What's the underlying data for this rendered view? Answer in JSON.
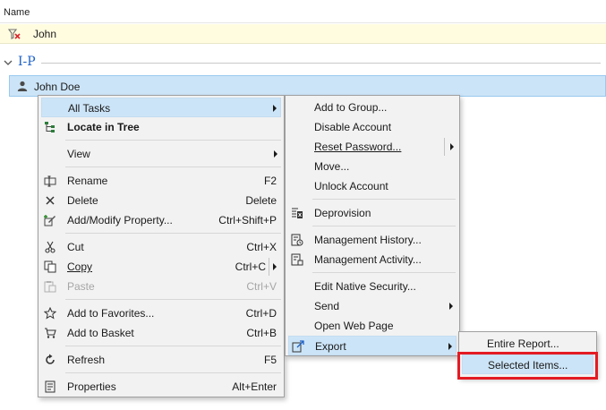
{
  "header": {
    "column_name": "Name"
  },
  "filter": {
    "value": "John"
  },
  "group": {
    "title": "I-P"
  },
  "selected_row": {
    "name": "John Doe"
  },
  "context_menu": {
    "all_tasks": "All Tasks",
    "locate_in_tree": "Locate in Tree",
    "view": "View",
    "rename": {
      "label": "Rename",
      "shortcut": "F2"
    },
    "delete": {
      "label": "Delete",
      "shortcut": "Delete"
    },
    "add_modify_property": {
      "label": "Add/Modify Property...",
      "shortcut": "Ctrl+Shift+P"
    },
    "cut": {
      "label": "Cut",
      "shortcut": "Ctrl+X"
    },
    "copy": {
      "label": "Copy",
      "shortcut": "Ctrl+C"
    },
    "paste": {
      "label": "Paste",
      "shortcut": "Ctrl+V"
    },
    "add_to_favorites": {
      "label": "Add to Favorites...",
      "shortcut": "Ctrl+D"
    },
    "add_to_basket": {
      "label": "Add to Basket",
      "shortcut": "Ctrl+B"
    },
    "refresh": {
      "label": "Refresh",
      "shortcut": "F5"
    },
    "properties": {
      "label": "Properties",
      "shortcut": "Alt+Enter"
    }
  },
  "all_tasks_menu": {
    "add_to_group": "Add to Group...",
    "disable_account": "Disable Account",
    "reset_password": "Reset Password...",
    "move": "Move...",
    "unlock_account": "Unlock Account",
    "deprovision": "Deprovision",
    "management_history": "Management History...",
    "management_activity": "Management Activity...",
    "edit_native_security": "Edit Native Security...",
    "send": "Send",
    "open_web_page": "Open Web Page",
    "export": "Export"
  },
  "export_menu": {
    "entire_report": "Entire Report...",
    "selected_items": "Selected Items..."
  },
  "colors": {
    "accent": "#1e62c8",
    "highlight": "#cce4f7",
    "annotation": "#e31b23",
    "filter_bg": "#fffce0"
  }
}
